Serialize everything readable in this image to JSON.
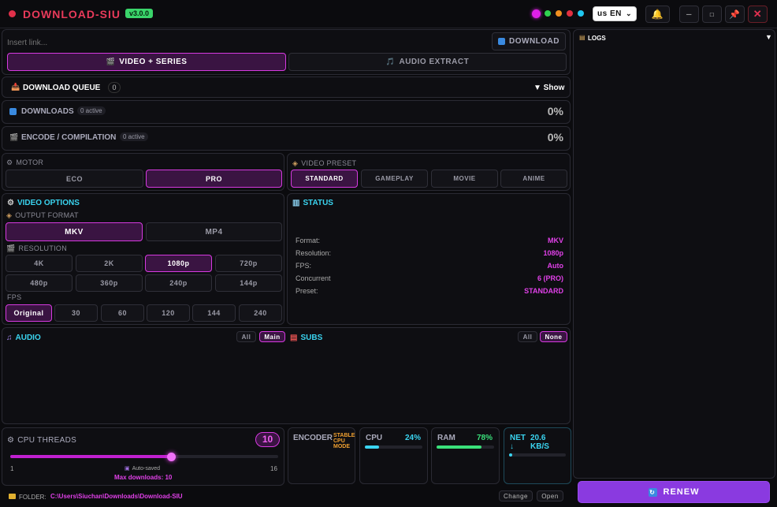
{
  "title_bar": {
    "app_title": "DOWNLOAD-SIU",
    "version": "v3.0.0",
    "language": "us EN"
  },
  "link_bar": {
    "placeholder": "Insert link...",
    "download_label": "DOWNLOAD"
  },
  "mode_tabs": {
    "video_label": "VIDEO + SERIES",
    "audio_label": "AUDIO EXTRACT"
  },
  "queue": {
    "title": "DOWNLOAD QUEUE",
    "count": "0",
    "show_label": "▼ Show"
  },
  "downloads": {
    "title": "DOWNLOADS",
    "badge": "0 active",
    "percent": "0%"
  },
  "encode": {
    "title": "ENCODE / COMPILATION",
    "badge": "0 active",
    "percent": "0%"
  },
  "motor": {
    "title": "MOTOR",
    "options": [
      "ECO",
      "PRO"
    ],
    "selected": "PRO"
  },
  "video_preset": {
    "title": "VIDEO PRESET",
    "options": [
      "STANDARD",
      "GAMEPLAY",
      "MOVIE",
      "ANIME"
    ],
    "selected": "STANDARD"
  },
  "video_options": {
    "title": "VIDEO OPTIONS",
    "output_format_label": "OUTPUT FORMAT",
    "formats": [
      "MKV",
      "MP4"
    ],
    "format_selected": "MKV",
    "resolution_label": "RESOLUTION",
    "resolutions": [
      "4K",
      "2K",
      "1080p",
      "720p",
      "480p",
      "360p",
      "240p",
      "144p"
    ],
    "resolution_selected": "1080p",
    "fps_label": "FPS",
    "fps": [
      "Original",
      "30",
      "60",
      "120",
      "144",
      "240"
    ],
    "fps_selected": "Original"
  },
  "status": {
    "title": "STATUS",
    "rows": [
      {
        "label": "Format:",
        "value": "MKV"
      },
      {
        "label": "Resolution:",
        "value": "1080p"
      },
      {
        "label": "FPS:",
        "value": "Auto"
      },
      {
        "label": "Concurrent",
        "value": "6 (PRO)"
      },
      {
        "label": "Preset:",
        "value": "STANDARD"
      }
    ]
  },
  "audio": {
    "title": "AUDIO",
    "all_label": "All",
    "main_label": "Main"
  },
  "subs": {
    "title": "SUBS",
    "all_label": "All",
    "none_label": "None"
  },
  "cpu_threads": {
    "title": "CPU THREADS",
    "value": "10",
    "min": "1",
    "max": "16",
    "autosaved": "Auto-saved",
    "max_downloads": "Max downloads: 10",
    "slider_value": 10
  },
  "encoder": {
    "title": "ENCODER",
    "mode_line1": "STABLE",
    "mode_line2": "CPU",
    "mode_line3": "MODE"
  },
  "cpu": {
    "title": "CPU",
    "percent": "24%",
    "fraction": 0.24
  },
  "ram": {
    "title": "RAM",
    "percent": "78%",
    "fraction": 0.78
  },
  "net": {
    "title": "NET",
    "arrow": "↓",
    "speed_line1": "20.6",
    "speed_line2": "KB/S",
    "fraction": 0.05
  },
  "folder": {
    "label": "FOLDER:",
    "path": "C:\\Users\\Siuchan\\Downloads\\Download-SIU",
    "change_label": "Change",
    "open_label": "Open"
  },
  "logs": {
    "title": "LOGS",
    "toggle": "▼"
  },
  "renew": {
    "label": "RENEW"
  },
  "colors": {
    "accent": "#e040e8",
    "cyan": "#3ad4f0",
    "green": "#3ae07a",
    "orange": "#f0a030",
    "purple": "#8a3ae0",
    "red": "#e0304a"
  }
}
